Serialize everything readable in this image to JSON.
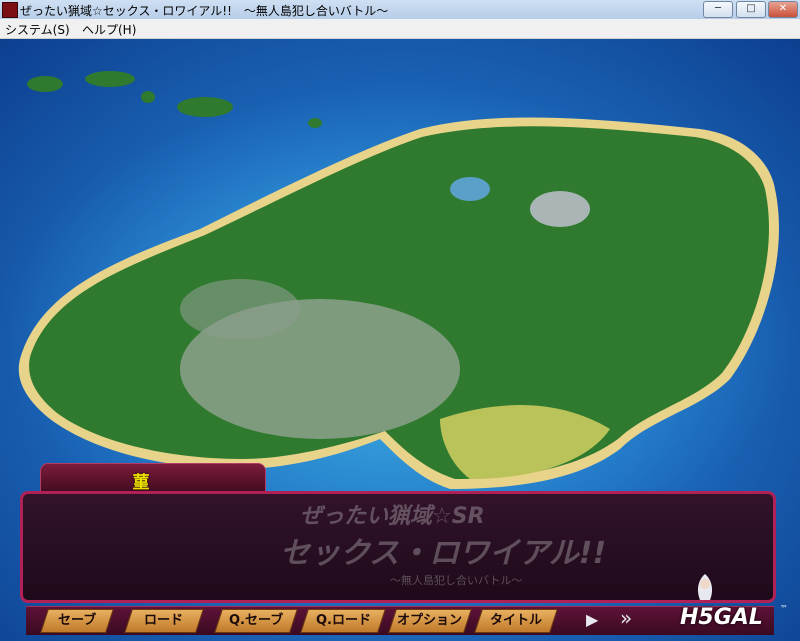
{
  "window": {
    "title": "ぜったい猟域☆セックス・ロワイアル!!　～無人島犯し合いバトル～",
    "min_label": "─",
    "max_label": "□",
    "close_label": "✕"
  },
  "menu": {
    "items": [
      "システム(S)",
      "ヘルプ(H)"
    ]
  },
  "dialogue": {
    "speaker": "菫"
  },
  "logo": {
    "line1": "ぜったい猟域☆SR",
    "line2": "セックス・ロワイアル!!",
    "line3": "～無人島犯し合いバトル～"
  },
  "toolbar": {
    "buttons": [
      "セーブ",
      "ロード",
      "Q.セーブ",
      "Q.ロード",
      "オプション",
      "タイトル"
    ],
    "play_icon": "play-icon",
    "skip_icon": "fast-forward-icon",
    "skip_label": "»",
    "play_label": "▶"
  },
  "watermark": {
    "text": "H5GAL",
    "tm": "™"
  },
  "colors": {
    "sea": "#1f6fc2",
    "window_border": "#b02158",
    "speaker": "#f0e000"
  }
}
